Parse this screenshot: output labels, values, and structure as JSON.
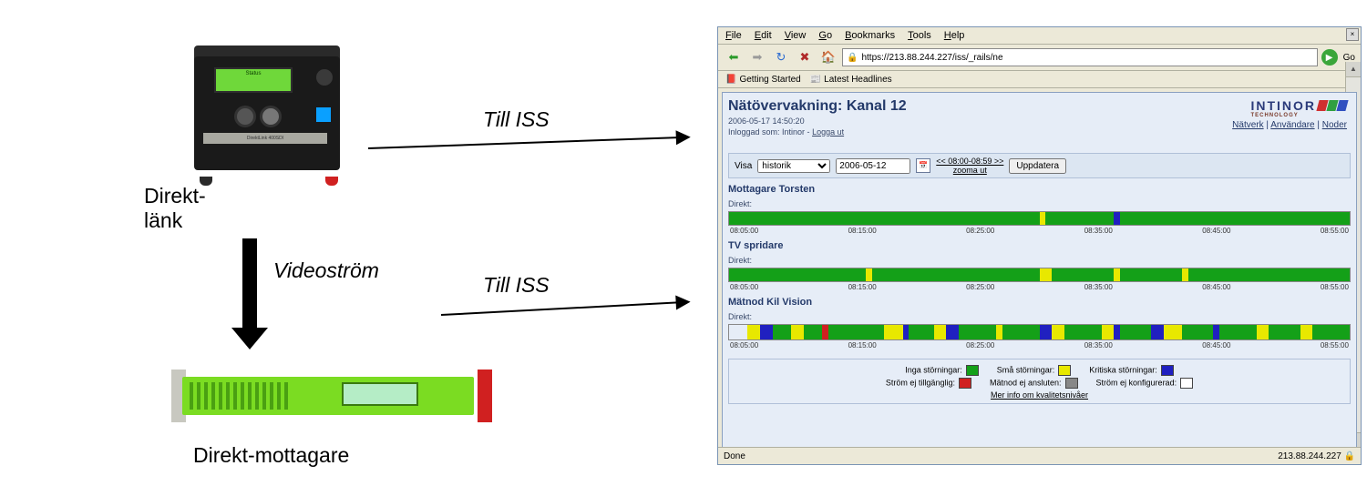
{
  "left": {
    "encoder_label_line1": "Direkt-",
    "encoder_label_line2": "länk",
    "receiver_label": "Direkt-mottagare",
    "videostream_label": "Videoström",
    "till_iss": "Till ISS",
    "enc_lcd_line": "Status"
  },
  "browser": {
    "menus": [
      "File",
      "Edit",
      "View",
      "Go",
      "Bookmarks",
      "Tools",
      "Help"
    ],
    "url": "https://213.88.244.227/iss/_rails/ne",
    "go_label": "Go",
    "book_started": "Getting Started",
    "book_headlines": "Latest Headlines"
  },
  "app": {
    "title": "Nätövervakning: Kanal 12",
    "timestamp": "2006-05-17 14:50:20",
    "logged_in_prefix": "Inloggad som: Intinor - ",
    "logout": "Logga ut",
    "links": {
      "natverk": "Nätverk",
      "anvandare": "Användare",
      "noder": "Noder"
    },
    "logo_text": "INTINOR",
    "logo_sub": "TECHNOLOGY",
    "controls": {
      "visa": "Visa",
      "mode": "historik",
      "date": "2006-05-12",
      "range": "<< 08:00-08:59 >>",
      "zoom": "zooma ut",
      "update": "Uppdatera"
    },
    "nodes": [
      {
        "title": "Mottagare Torsten",
        "label": "Direkt:"
      },
      {
        "title": "TV spridare",
        "label": "Direkt:"
      },
      {
        "title": "Mätnod Kil Vision",
        "label": "Direkt:"
      }
    ],
    "ticks": [
      "08:05:00",
      "08:15:00",
      "08:25:00",
      "08:35:00",
      "08:45:00",
      "08:55:00"
    ],
    "legend": {
      "inga": "Inga störningar:",
      "sma": "Små störningar:",
      "kritiska": "Kritiska störningar:",
      "stromej": "Ström ej tillgänglig:",
      "matnodej": "Mätnod ej ansluten:",
      "stromejk": "Ström ej konfigurerad:",
      "more": "Mer info om kvalitetsnivåer"
    }
  },
  "status": {
    "left": "Done",
    "right": "213.88.244.227"
  }
}
